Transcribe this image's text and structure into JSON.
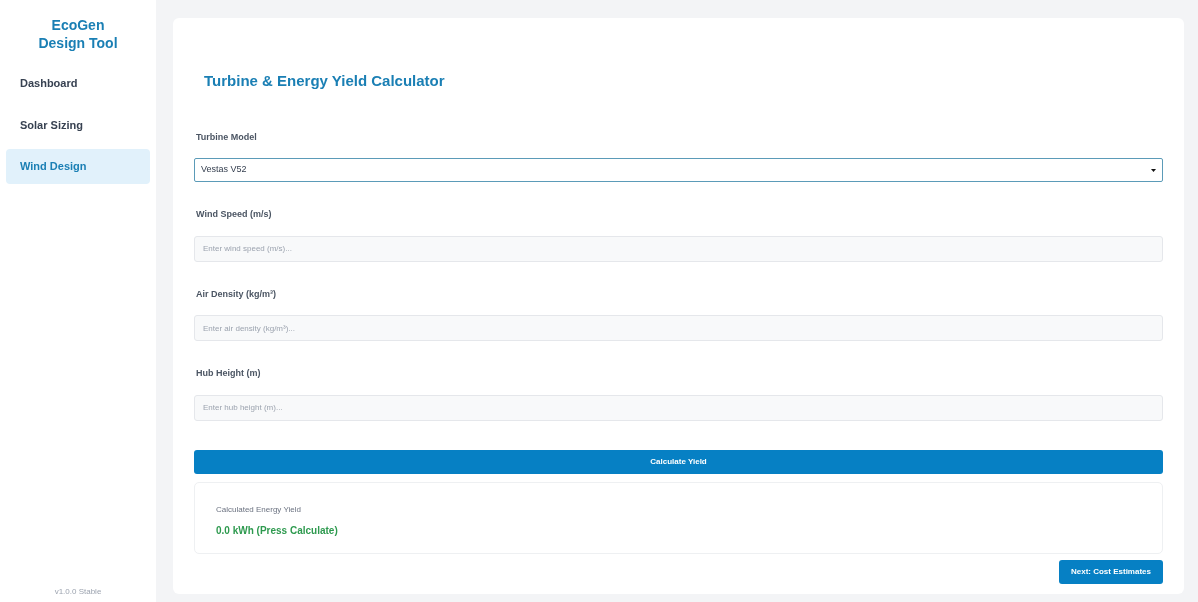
{
  "sidebar": {
    "brand": [
      "EcoGen",
      "Design Tool"
    ],
    "items": [
      {
        "label": "Dashboard",
        "selected": false
      },
      {
        "label": "Solar Sizing",
        "selected": false
      },
      {
        "label": "Wind Design",
        "selected": true
      }
    ],
    "version": "v1.0.0 Stable"
  },
  "main": {
    "title": "Turbine & Energy Yield Calculator",
    "fields": [
      {
        "kind": "select",
        "label": "Turbine Model",
        "value": "Vestas V52"
      },
      {
        "kind": "input",
        "label": "Wind Speed (m/s)",
        "placeholder": "Enter wind speed (m/s)..."
      },
      {
        "kind": "input",
        "label": "Air Density (kg/m³)",
        "placeholder": "Enter air density (kg/m³)..."
      },
      {
        "kind": "input",
        "label": "Hub Height (m)",
        "placeholder": "Enter hub height (m)..."
      }
    ],
    "calculate_button": "Calculate Yield",
    "result": {
      "label": "Calculated Energy Yield",
      "value": "0.0 kWh (Press Calculate)"
    },
    "next_button": "Next: Cost Estimates"
  }
}
